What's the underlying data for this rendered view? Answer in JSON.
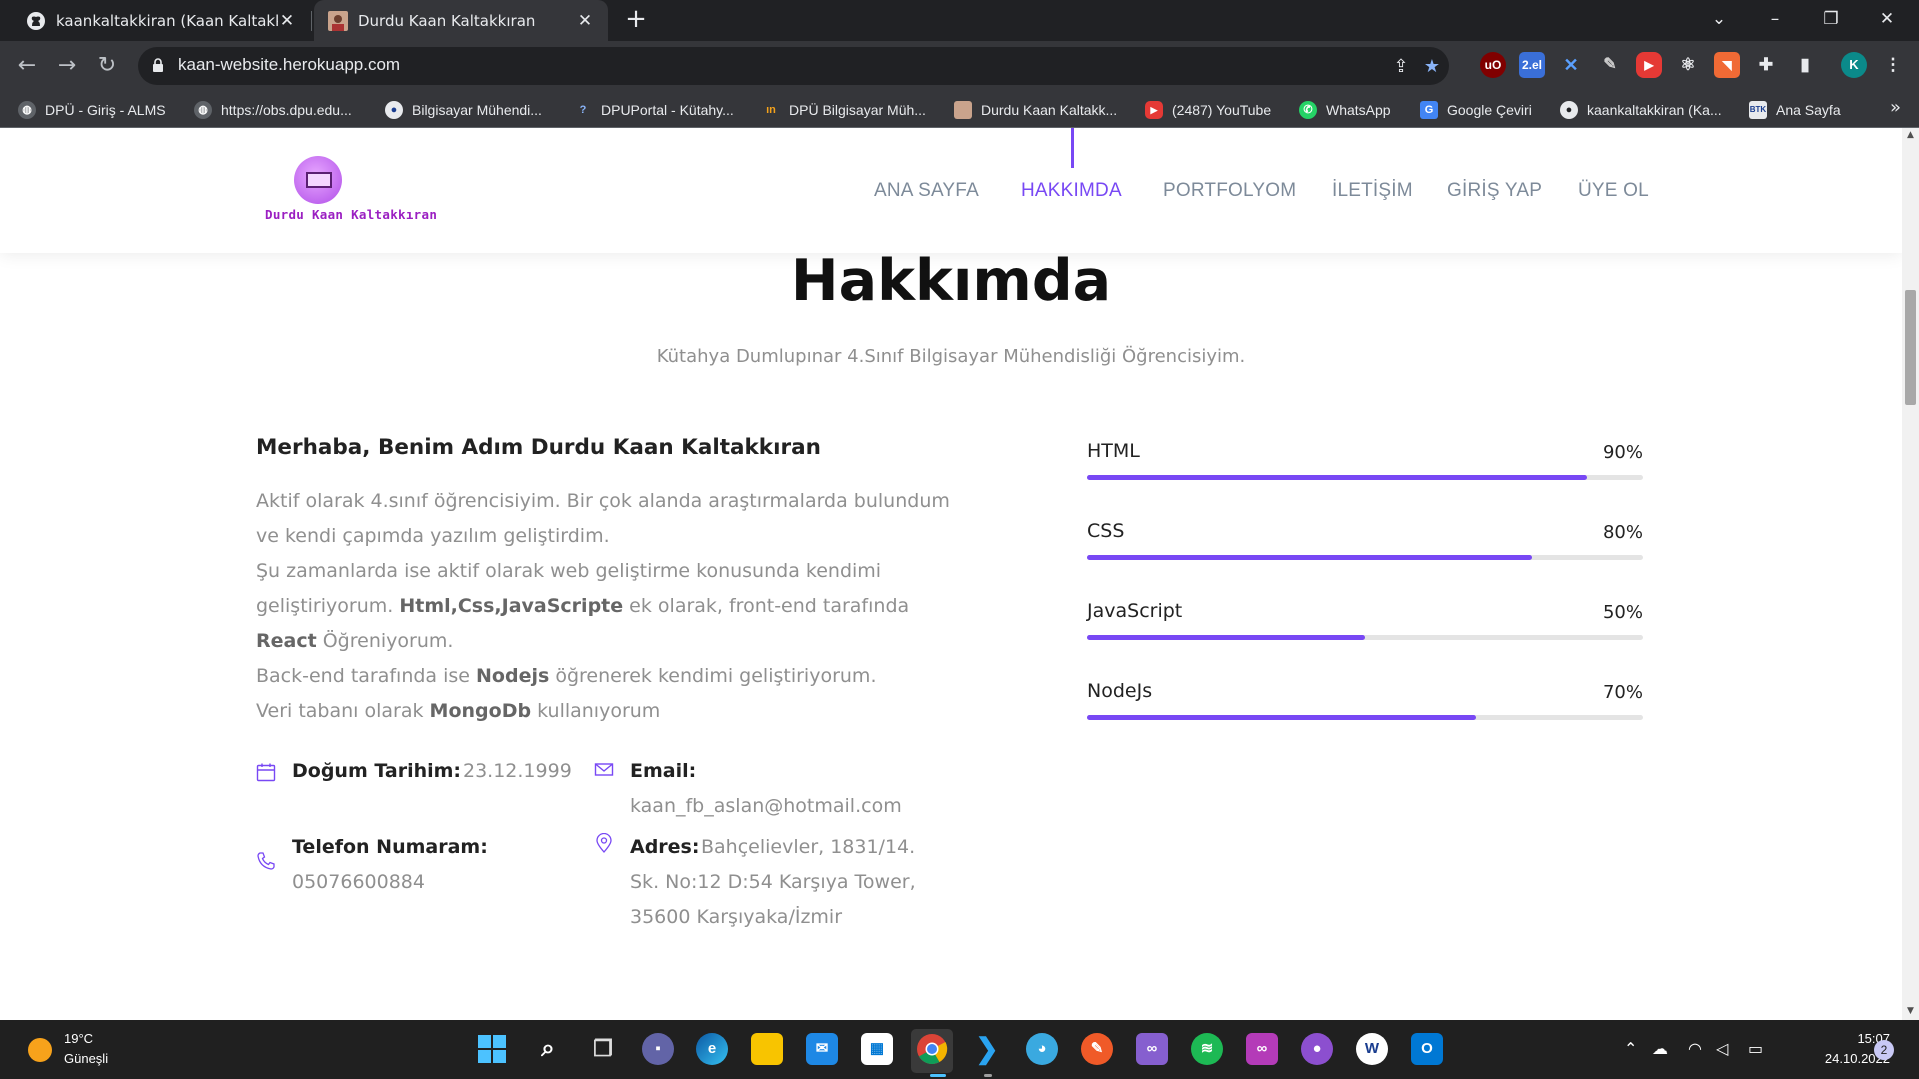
{
  "browser": {
    "tabs": [
      {
        "title": "kaankaltakkiran (Kaan Kaltakkıran)",
        "active": false
      },
      {
        "title": "Durdu Kaan Kaltakkıran",
        "active": true
      }
    ],
    "new_tab_icon": "+",
    "url": "kaan-website.herokuapp.com",
    "profile_initial": "K",
    "extensions": [
      "uBlock",
      "2.el",
      "tool",
      "brush",
      "youtube",
      "react",
      "rss",
      "puzzle",
      "sidebar"
    ],
    "bookmarks": [
      {
        "label": "DPÜ - Giriş - ALMS",
        "icon": "globe-icon"
      },
      {
        "label": "https://obs.dpu.edu...",
        "icon": "globe-icon"
      },
      {
        "label": "Bilgisayar Mühendi...",
        "icon": "dpu-icon"
      },
      {
        "label": "DPUPortal - Kütahy...",
        "icon": "question-icon"
      },
      {
        "label": "DPÜ Bilgisayar Müh...",
        "icon": "in-icon"
      },
      {
        "label": "Durdu Kaan Kaltakk...",
        "icon": "profile-icon"
      },
      {
        "label": "(2487) YouTube",
        "icon": "youtube-icon"
      },
      {
        "label": "WhatsApp",
        "icon": "whatsapp-icon"
      },
      {
        "label": "Google Çeviri",
        "icon": "translate-icon"
      },
      {
        "label": "kaankaltakkiran (Ka...",
        "icon": "github-icon"
      },
      {
        "label": "Ana Sayfa",
        "icon": "btk-icon"
      }
    ],
    "bookmarks_more": "»"
  },
  "site": {
    "logo_text": "Durdu Kaan Kaltakkıran",
    "nav": [
      {
        "label": "ANA SAYFA",
        "active": false
      },
      {
        "label": "HAKKIMDA",
        "active": true
      },
      {
        "label": "PORTFOLYOM",
        "active": false
      },
      {
        "label": "İLETİŞİM",
        "active": false
      },
      {
        "label": "GİRİŞ YAP",
        "active": false
      },
      {
        "label": "ÜYE OL",
        "active": false
      }
    ],
    "accent_color": "#7848f4"
  },
  "about": {
    "title": "Hakkımda",
    "subtitle": "Kütahya Dumlupınar 4.Sınıf Bilgisayar Mühendisliği Öğrencisiyim.",
    "heading": "Merhaba, Benim Adım Durdu Kaan Kaltakkıran",
    "para": {
      "l1": "Aktif olarak 4.sınıf öğrencisiyim. Bir çok alanda araştırmalarda bulundum ve kendi çapımda yazılım geliştirdim.",
      "l2a": "Şu zamanlarda ise aktif olarak web geliştirme konusunda kendimi geliştiriyorum. ",
      "l2b": "Html,Css,JavaScripte",
      "l2c": " ek olarak, front-end tarafında ",
      "l2d": "React",
      "l2e": " Öğreniyorum.",
      "l3a": "Back-end tarafında ise ",
      "l3b": "Nodejs",
      "l3c": " öğrenerek kendimi geliştiriyorum.",
      "l4a": "Veri tabanı olarak ",
      "l4b": "MongoDb",
      "l4c": " kullanıyorum"
    },
    "info": {
      "birth_label": "Doğum Tarihim:",
      "birth_value": "23.12.1999",
      "email_label": "Email:",
      "email_value": "kaan_fb_aslan@hotmail.com",
      "phone_label": "Telefon Numaram:",
      "phone_value": "05076600884",
      "address_label": "Adres:",
      "address_l1": "Bahçelievler, 1831/14.",
      "address_l2": "Sk. No:12 D:54 Karşıya Tower,",
      "address_l3": "35600 Karşıyaka/İzmir"
    },
    "skills": [
      {
        "name": "HTML",
        "percent_label": "90%",
        "value": 90
      },
      {
        "name": "CSS",
        "percent_label": "80%",
        "value": 80
      },
      {
        "name": "JavaScript",
        "percent_label": "50%",
        "value": 50
      },
      {
        "name": "NodeJs",
        "percent_label": "70%",
        "value": 70
      }
    ]
  },
  "taskbar": {
    "weather_temp": "19°C",
    "weather_desc": "Güneşli",
    "time": "15:07",
    "date": "24.10.2022",
    "notification_count": "2",
    "apps": [
      "start",
      "search",
      "task-view",
      "teams-chat",
      "edge",
      "file-explorer",
      "mail",
      "store",
      "chrome",
      "vscode",
      "globe",
      "pen",
      "visual-studio",
      "spotify",
      "arduino",
      "github-desktop",
      "word",
      "outlook"
    ]
  }
}
